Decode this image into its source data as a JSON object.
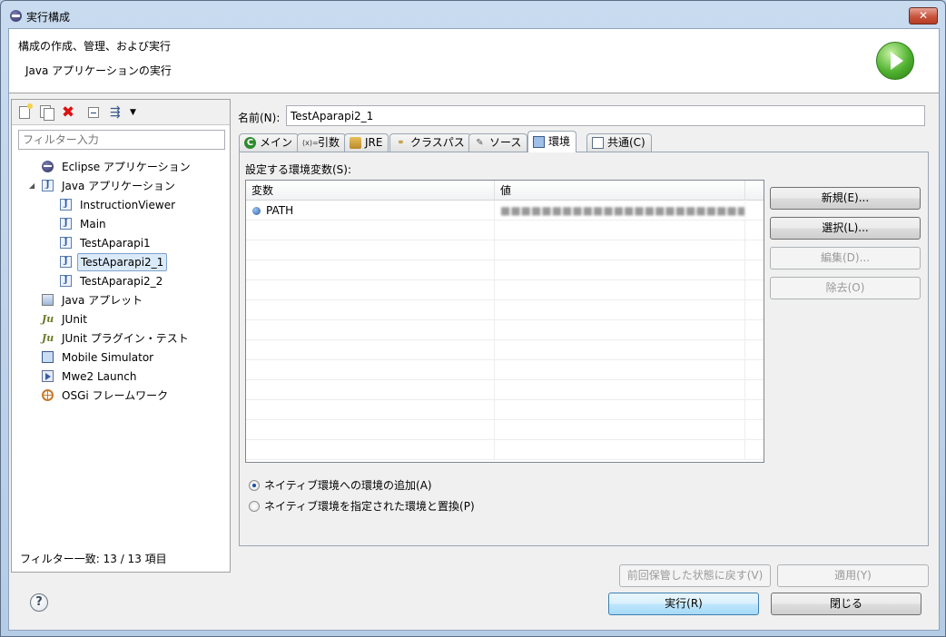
{
  "window": {
    "title": "実行構成",
    "close_label": "✕"
  },
  "header": {
    "title": "構成の作成、管理、および実行",
    "description": "Java アプリケーションの実行"
  },
  "left": {
    "filter_placeholder": "フィルター入力",
    "filter_status": "フィルター一致: 13 / 13 項目",
    "tree": [
      {
        "label": "Eclipse アプリケーション",
        "icon": "eclipse-icon"
      },
      {
        "label": "Java アプリケーション",
        "icon": "java-app-icon",
        "expanded": true
      },
      {
        "label": "InstructionViewer",
        "icon": "java-config-icon"
      },
      {
        "label": "Main",
        "icon": "java-config-icon"
      },
      {
        "label": "TestAparapi1",
        "icon": "java-config-icon"
      },
      {
        "label": "TestAparapi2_1",
        "icon": "java-config-icon",
        "selected": true
      },
      {
        "label": "TestAparapi2_2",
        "icon": "java-config-icon"
      },
      {
        "label": "Java アプレット",
        "icon": "applet-icon"
      },
      {
        "label": "JUnit",
        "icon": "junit-icon"
      },
      {
        "label": "JUnit プラグイン・テスト",
        "icon": "junit-plugin-icon"
      },
      {
        "label": "Mobile Simulator",
        "icon": "mobile-icon"
      },
      {
        "label": "Mwe2 Launch",
        "icon": "mwe2-icon"
      },
      {
        "label": "OSGi フレームワーク",
        "icon": "osgi-icon"
      }
    ]
  },
  "config": {
    "name_label": "名前(N):",
    "name_value": "TestAparapi2_1",
    "tabs": [
      {
        "label": "メイン",
        "icon": "main-tab-icon"
      },
      {
        "label": "引数",
        "icon": "arguments-tab-icon"
      },
      {
        "label": "JRE",
        "icon": "jre-tab-icon"
      },
      {
        "label": "クラスパス",
        "icon": "classpath-tab-icon"
      },
      {
        "label": "ソース",
        "icon": "source-tab-icon"
      },
      {
        "label": "環境",
        "icon": "environment-tab-icon",
        "active": true
      },
      {
        "label": "共通(C)",
        "icon": "common-tab-icon"
      }
    ],
    "env_label": "設定する環境変数(S):",
    "table": {
      "headers": [
        "変数",
        "値"
      ],
      "rows": [
        {
          "variable": "PATH",
          "value": "■■■■■■■■■■■■■■■■■■■■■■■■…"
        }
      ]
    },
    "buttons": {
      "new": "新規(E)...",
      "select": "選択(L)...",
      "edit": "編集(D)...",
      "remove": "除去(O)"
    },
    "radio_append": "ネイティブ環境への環境の追加(A)",
    "radio_replace": "ネイティブ環境を指定された環境と置換(P)",
    "revert": "前回保管した状態に戻す(V)",
    "apply": "適用(Y)"
  },
  "footer": {
    "help_label": "?",
    "run": "実行(R)",
    "close": "閉じる"
  }
}
